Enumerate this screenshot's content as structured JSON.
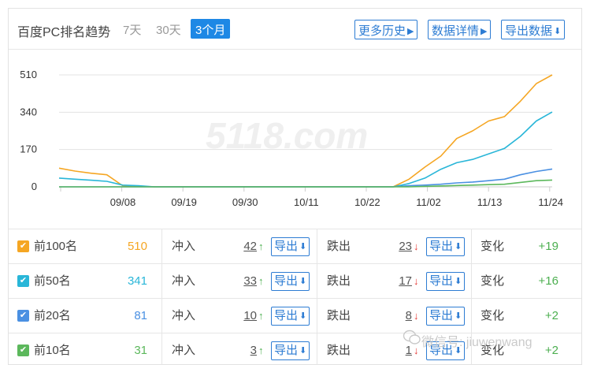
{
  "header": {
    "title": "百度PC排名趋势",
    "ranges": [
      "7天",
      "30天",
      "3个月"
    ],
    "active_range": "3个月",
    "buttons": [
      {
        "label": "更多历史",
        "icon": "caret-right-icon"
      },
      {
        "label": "数据详情",
        "icon": "caret-right-icon"
      },
      {
        "label": "导出数据",
        "icon": "download-icon"
      }
    ]
  },
  "watermark": {
    "chart_text": "5118.com",
    "footer_text": "微信号: jiuwenwang"
  },
  "chart_data": {
    "type": "line",
    "x": [
      "09/08",
      "09/19",
      "09/30",
      "10/11",
      "10/22",
      "11/02",
      "11/13",
      "11/24"
    ],
    "y_ticks": [
      0,
      170,
      340,
      510
    ],
    "ylim": [
      0,
      510
    ],
    "grid": true,
    "series": [
      {
        "name": "前100名",
        "color": "#f5a623",
        "values": [
          85,
          72,
          62,
          55,
          5,
          2,
          0,
          0,
          0,
          0,
          0,
          0,
          0,
          0,
          0,
          0,
          0,
          0,
          0,
          0,
          0,
          0,
          35,
          90,
          140,
          220,
          255,
          300,
          320,
          390,
          470,
          510
        ]
      },
      {
        "name": "前50名",
        "color": "#29b6d8",
        "values": [
          40,
          35,
          30,
          25,
          8,
          5,
          0,
          0,
          0,
          0,
          0,
          0,
          0,
          0,
          0,
          0,
          0,
          0,
          0,
          0,
          0,
          0,
          15,
          40,
          80,
          110,
          125,
          150,
          175,
          230,
          300,
          341
        ]
      },
      {
        "name": "前20名",
        "color": "#4a90e2",
        "values": [
          0,
          0,
          0,
          0,
          0,
          0,
          0,
          0,
          0,
          0,
          0,
          0,
          0,
          0,
          0,
          0,
          0,
          0,
          0,
          0,
          0,
          0,
          5,
          8,
          12,
          18,
          22,
          28,
          35,
          55,
          70,
          81
        ]
      },
      {
        "name": "前10名",
        "color": "#5cb85c",
        "values": [
          0,
          0,
          0,
          0,
          0,
          0,
          0,
          0,
          0,
          0,
          0,
          0,
          0,
          0,
          0,
          0,
          0,
          0,
          0,
          0,
          0,
          0,
          0,
          2,
          4,
          6,
          8,
          10,
          12,
          20,
          28,
          31
        ]
      }
    ]
  },
  "table": {
    "rows": [
      {
        "name": "前100名",
        "value": "510",
        "color": "#f5a623",
        "in_label": "冲入",
        "in_count": "42",
        "in_arrow": "↑",
        "export_label": "导出",
        "out_label": "跌出",
        "out_count": "23",
        "out_arrow": "↓",
        "change_label": "变化",
        "change": "+19"
      },
      {
        "name": "前50名",
        "value": "341",
        "color": "#29b6d8",
        "in_label": "冲入",
        "in_count": "33",
        "in_arrow": "↑",
        "export_label": "导出",
        "out_label": "跌出",
        "out_count": "17",
        "out_arrow": "↓",
        "change_label": "变化",
        "change": "+16"
      },
      {
        "name": "前20名",
        "value": "81",
        "color": "#4a90e2",
        "in_label": "冲入",
        "in_count": "10",
        "in_arrow": "↑",
        "export_label": "导出",
        "out_label": "跌出",
        "out_count": "8",
        "out_arrow": "↓",
        "change_label": "变化",
        "change": "+2"
      },
      {
        "name": "前10名",
        "value": "31",
        "color": "#5cb85c",
        "in_label": "冲入",
        "in_count": "3",
        "in_arrow": "↑",
        "export_label": "导出",
        "out_label": "跌出",
        "out_count": "1",
        "out_arrow": "↓",
        "change_label": "变化",
        "change": "+2"
      }
    ]
  }
}
